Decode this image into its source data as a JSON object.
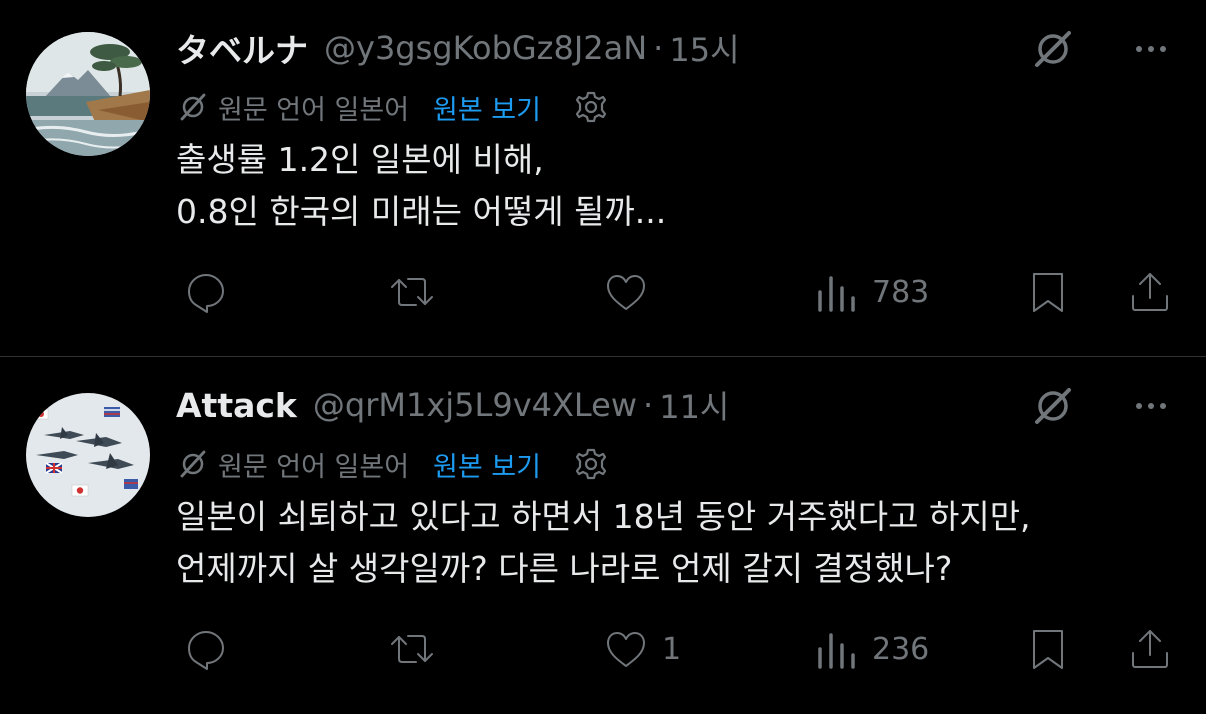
{
  "tweets": [
    {
      "name": "タベルナ",
      "handle": "@y3gsgKobGz8J2aN",
      "separator": "·",
      "time": "15시",
      "translate_label": "원문 언어 일본어",
      "translate_link": "원본 보기",
      "text_lines": [
        "출생률 1.2인 일본에 비해,",
        "0.8인 한국의 미래는 어떻게 될까..."
      ],
      "reply_count": "",
      "retweet_count": "",
      "like_count": "",
      "views_count": "783"
    },
    {
      "name": "Attack",
      "handle": "@qrM1xj5L9v4XLew",
      "separator": "·",
      "time": "11시",
      "translate_label": "원문 언어 일본어",
      "translate_link": "원본 보기",
      "text_lines": [
        "일본이 쇠퇴하고 있다고 하면서 18년 동안 거주했다고 하지만,",
        "언제까지 살 생각일까? 다른 나라로 언제 갈지 결정했나?"
      ],
      "reply_count": "",
      "retweet_count": "",
      "like_count": "1",
      "views_count": "236"
    }
  ],
  "colors": {
    "background": "#000000",
    "text": "#e7e9ea",
    "secondary": "#71767b",
    "link": "#1d9bf0",
    "divider": "#2f3336"
  },
  "icons": {
    "grok": "grok-icon",
    "more": "more-horizontal-icon",
    "translate": "translate-icon",
    "settings": "gear-icon",
    "reply": "reply-icon",
    "retweet": "retweet-icon",
    "like": "heart-icon",
    "views": "views-icon",
    "bookmark": "bookmark-icon",
    "share": "share-icon"
  }
}
